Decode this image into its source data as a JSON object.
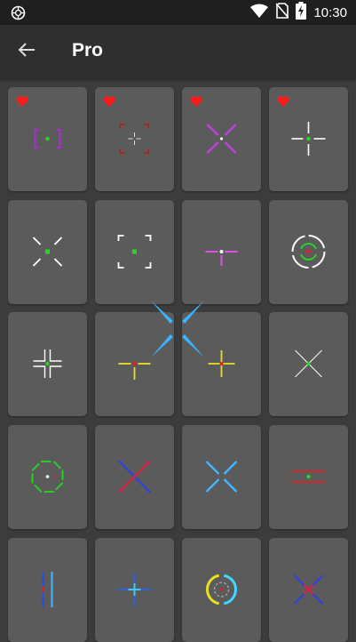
{
  "status_bar": {
    "time": "10:30",
    "icons": [
      "settings-gear-icon",
      "wifi-icon",
      "no-sim-icon",
      "battery-charging-icon"
    ]
  },
  "app_bar": {
    "title": "Pro",
    "back_icon": "arrow-back-icon"
  },
  "colors": {
    "status_bar_bg": "#1f1f1f",
    "app_bar_bg": "#2f2f2f",
    "page_bg": "#3c3c3c",
    "tile_bg": "#5b5b5b",
    "favorite_heart": "#ff1a1a"
  },
  "crosshairs": [
    {
      "name": "brackets-magenta",
      "favorite": true
    },
    {
      "name": "corners-red",
      "favorite": true
    },
    {
      "name": "x-magenta",
      "favorite": true
    },
    {
      "name": "gap-cross-white",
      "favorite": true
    },
    {
      "name": "diagonal-corners-white",
      "favorite": false
    },
    {
      "name": "square-corners-white",
      "favorite": false
    },
    {
      "name": "t-magenta",
      "favorite": false
    },
    {
      "name": "circle-target-green",
      "favorite": false
    },
    {
      "name": "split-cross-white",
      "favorite": false
    },
    {
      "name": "cross-yellow-red",
      "favorite": false
    },
    {
      "name": "cross-yellow",
      "favorite": false
    },
    {
      "name": "x-thin-white",
      "favorite": false
    },
    {
      "name": "octagon-green",
      "favorite": false
    },
    {
      "name": "x-red-blue",
      "favorite": false
    },
    {
      "name": "x-cyan",
      "favorite": false
    },
    {
      "name": "double-line-red",
      "favorite": false
    },
    {
      "name": "vertical-bars-blue",
      "favorite": false
    },
    {
      "name": "cross-cyan-blue",
      "favorite": false
    },
    {
      "name": "ring-multicolor",
      "favorite": false
    },
    {
      "name": "x-blue-red",
      "favorite": false
    }
  ]
}
